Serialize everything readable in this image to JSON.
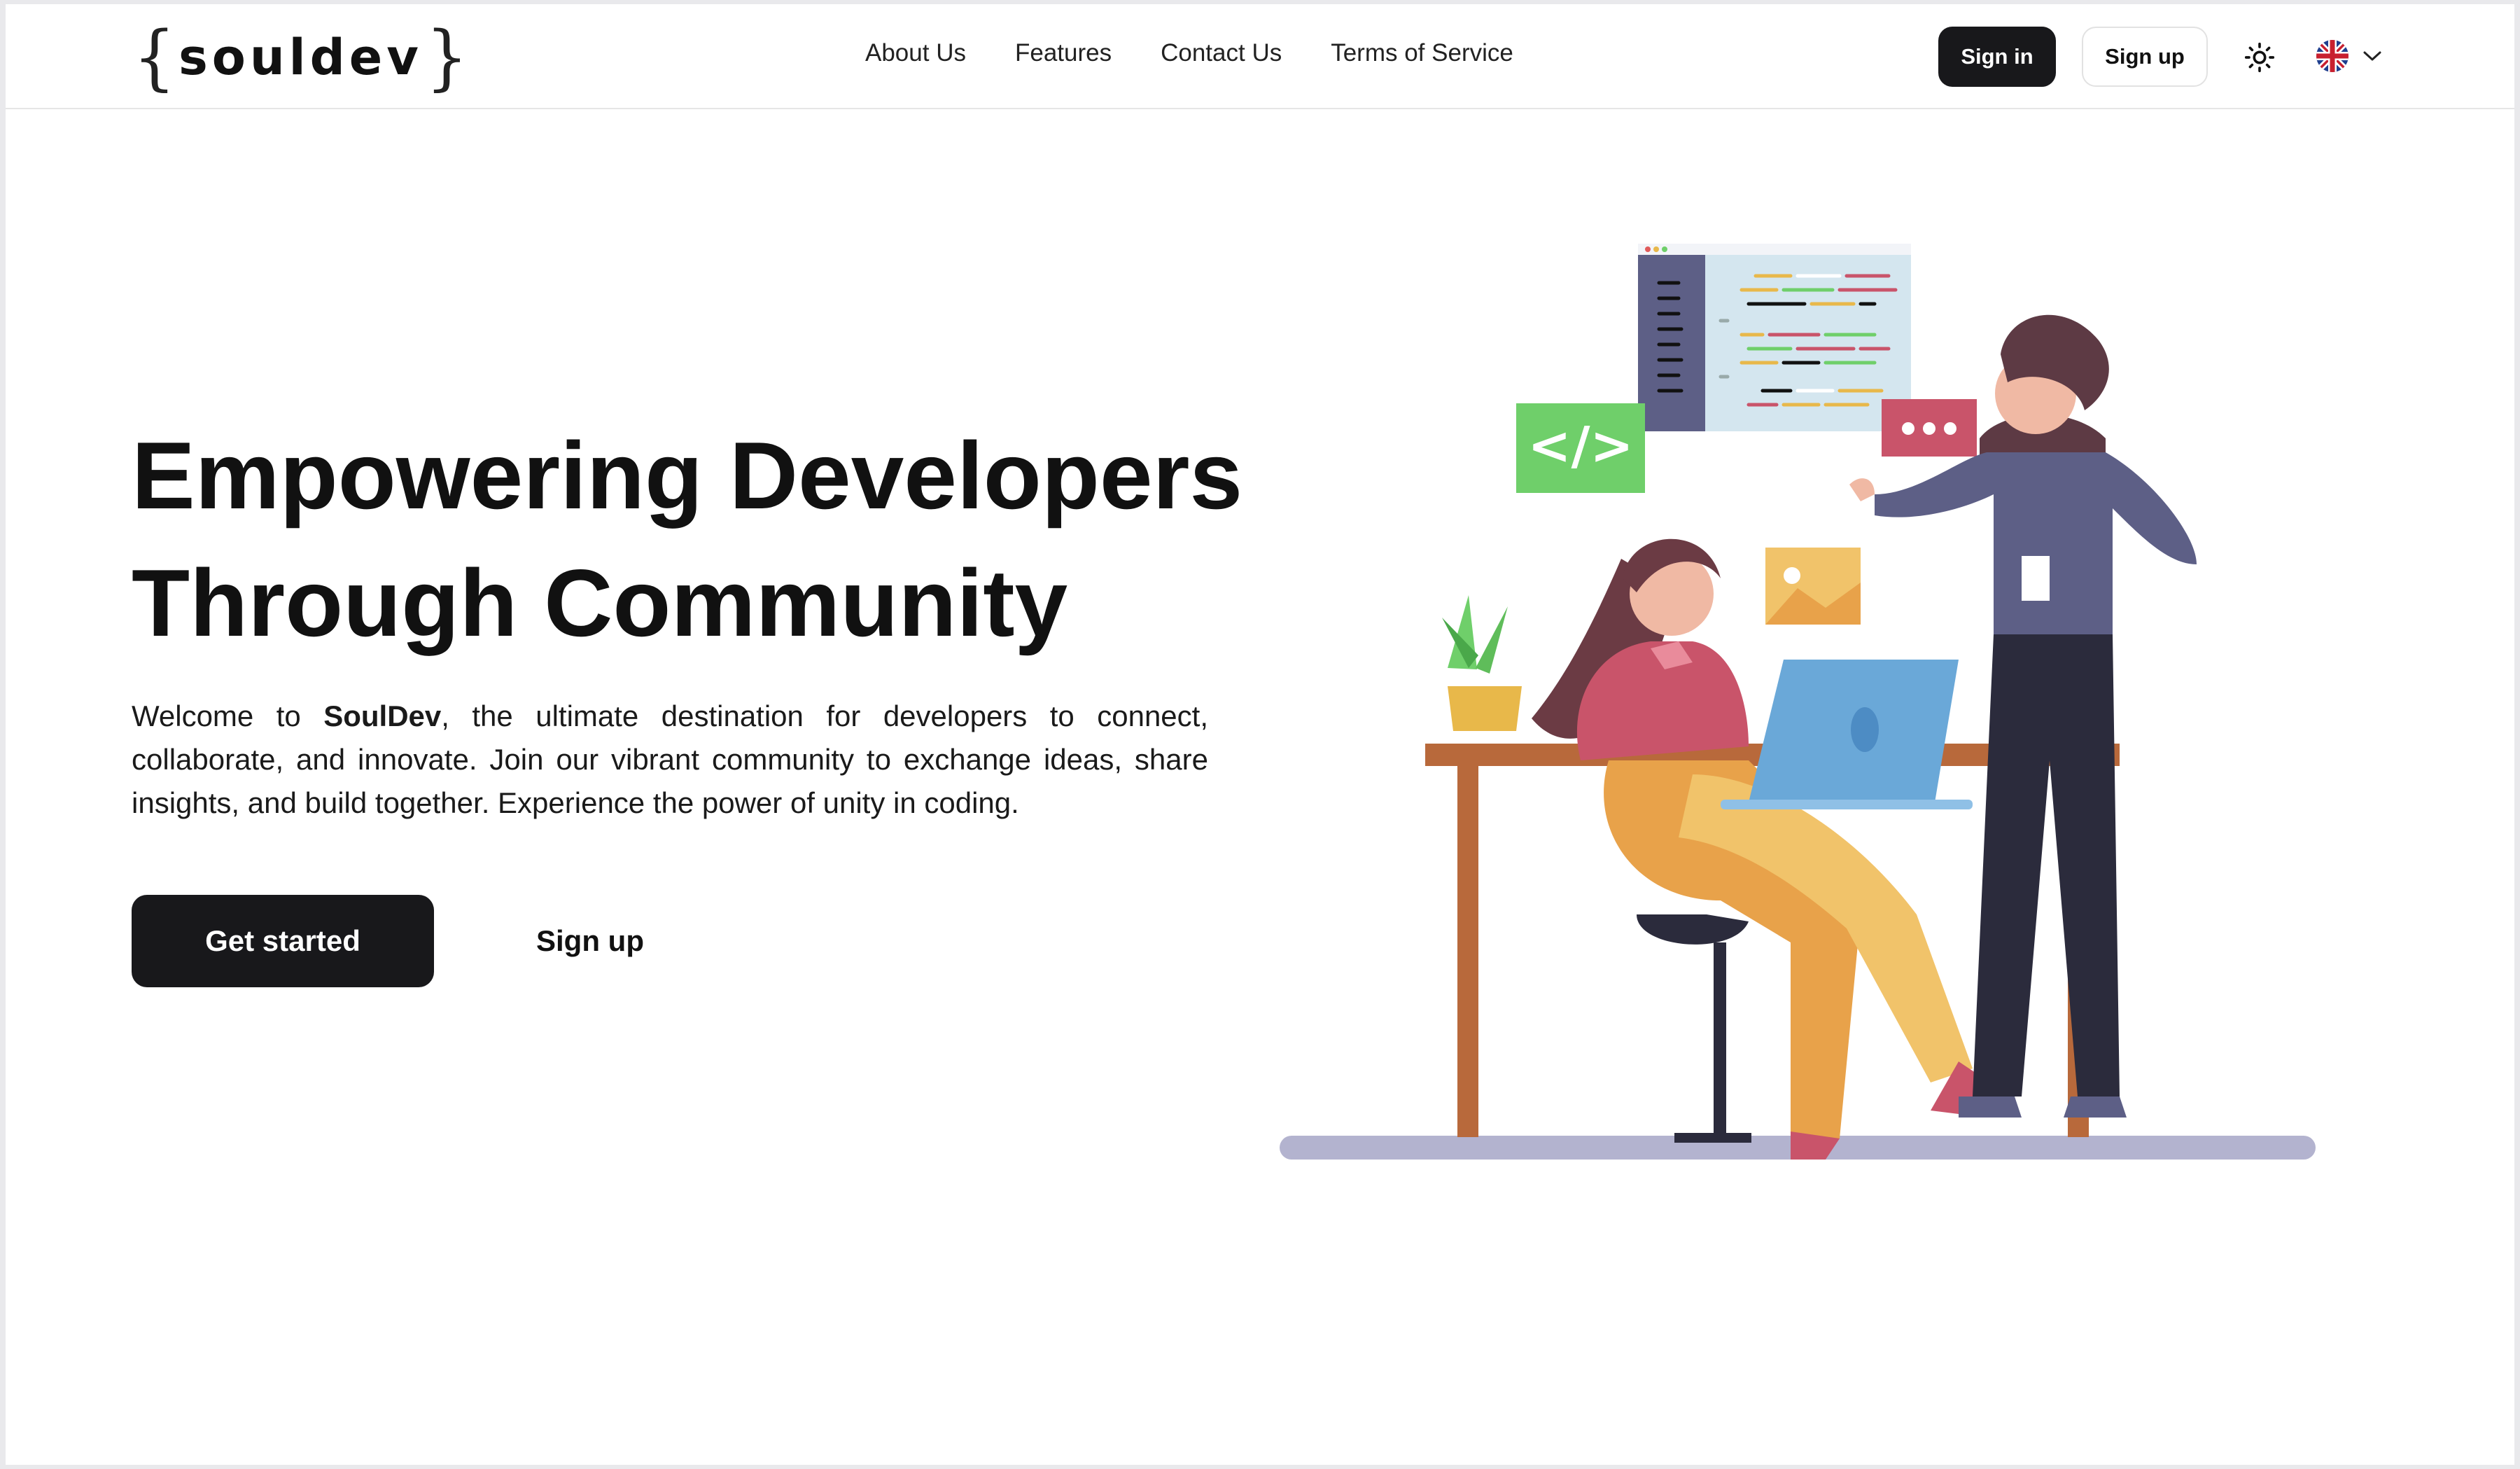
{
  "brand": {
    "name": "souldev",
    "brace_open": "{",
    "brace_close": "}"
  },
  "nav": {
    "links": [
      {
        "label": "About Us"
      },
      {
        "label": "Features"
      },
      {
        "label": "Contact Us"
      },
      {
        "label": "Terms of Service"
      }
    ],
    "sign_in": "Sign in",
    "sign_up": "Sign up",
    "theme_icon": "sun-icon",
    "language_icon": "uk-flag-icon",
    "language_dropdown_icon": "chevron-down-icon"
  },
  "hero": {
    "title_line1": "Empowering Developers",
    "title_line2": "Through Community",
    "desc_prefix": "Welcome to ",
    "desc_brand": "SoulDev",
    "desc_suffix": ", the ultimate destination for developers to connect, collaborate, and innovate. Join our vibrant community to exchange ideas, share insights, and build together. Experience the power of unity in coding.",
    "cta_primary": "Get started",
    "cta_secondary": "Sign up",
    "code_badge": "</>"
  },
  "colors": {
    "primary_button": "#18181b",
    "background": "#ffffff",
    "text": "#111111",
    "illustration_green": "#6fcf6a",
    "illustration_pink": "#c9546a",
    "illustration_blue": "#6aa8d8",
    "illustration_orange": "#e8a24a"
  }
}
